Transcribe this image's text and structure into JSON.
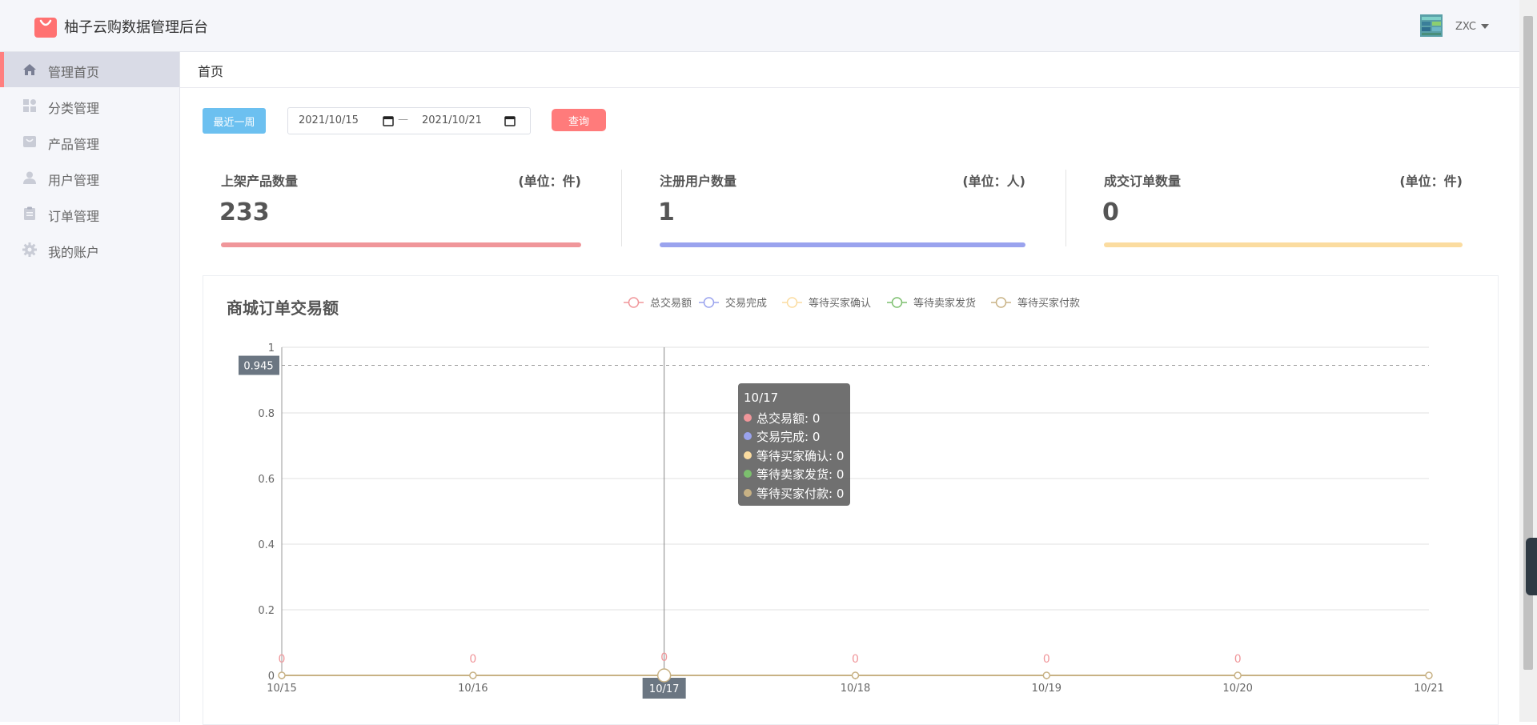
{
  "header": {
    "title": "柚子云购数据管理后台",
    "user": "ZXC"
  },
  "sidebar": {
    "items": [
      {
        "label": "管理首页",
        "icon": "home-icon",
        "active": true
      },
      {
        "label": "分类管理",
        "icon": "category-icon",
        "active": false
      },
      {
        "label": "产品管理",
        "icon": "product-icon",
        "active": false
      },
      {
        "label": "用户管理",
        "icon": "user-icon",
        "active": false
      },
      {
        "label": "订单管理",
        "icon": "order-icon",
        "active": false
      },
      {
        "label": "我的账户",
        "icon": "gear-icon",
        "active": false
      }
    ]
  },
  "breadcrumb": "首页",
  "filters": {
    "week_button": "最近一周",
    "start_date": "2021/10/15",
    "separator": "—",
    "end_date": "2021/10/21",
    "query_button": "查询"
  },
  "stats": [
    {
      "title": "上架产品数量",
      "unit": "(单位：件)",
      "value": "233",
      "color": "#f0969a"
    },
    {
      "title": "注册用户数量",
      "unit": "(单位：人)",
      "value": "1",
      "color": "#9aa3ee"
    },
    {
      "title": "成交订单数量",
      "unit": "(单位：件)",
      "value": "0",
      "color": "#fbdca0"
    }
  ],
  "chart_title": "商城订单交易额",
  "chart_data": {
    "type": "line",
    "title": "商城订单交易额",
    "x": [
      "10/15",
      "10/16",
      "10/17",
      "10/18",
      "10/19",
      "10/20",
      "10/21"
    ],
    "ylim": [
      0,
      1
    ],
    "yticks": [
      "0",
      "0.2",
      "0.4",
      "0.6",
      "0.8",
      "1"
    ],
    "series": [
      {
        "name": "总交易额",
        "color": "#f0969a",
        "values": [
          0,
          0,
          0,
          0,
          0,
          0,
          0
        ]
      },
      {
        "name": "交易完成",
        "color": "#9aa3ee",
        "values": [
          0,
          0,
          0,
          0,
          0,
          0,
          0
        ]
      },
      {
        "name": "等待买家确认",
        "color": "#fbdca0",
        "values": [
          0,
          0,
          0,
          0,
          0,
          0,
          0
        ]
      },
      {
        "name": "等待卖家发货",
        "color": "#7cbf6e",
        "values": [
          0,
          0,
          0,
          0,
          0,
          0,
          0
        ]
      },
      {
        "name": "等待买家付款",
        "color": "#c8b285",
        "values": [
          0,
          0,
          0,
          0,
          0,
          0,
          0
        ]
      }
    ],
    "data_labels": [
      "0",
      "0",
      "0",
      "0",
      "0",
      "0"
    ],
    "grid": true,
    "legend": "top-center",
    "crosshair": {
      "x": "10/17",
      "y": 0.945,
      "y_label": "0.945"
    },
    "tooltip": {
      "title": "10/17",
      "rows": [
        "总交易额: 0",
        "交易完成: 0",
        "等待买家确认: 0",
        "等待卖家发货: 0",
        "等待买家付款: 0"
      ]
    }
  }
}
